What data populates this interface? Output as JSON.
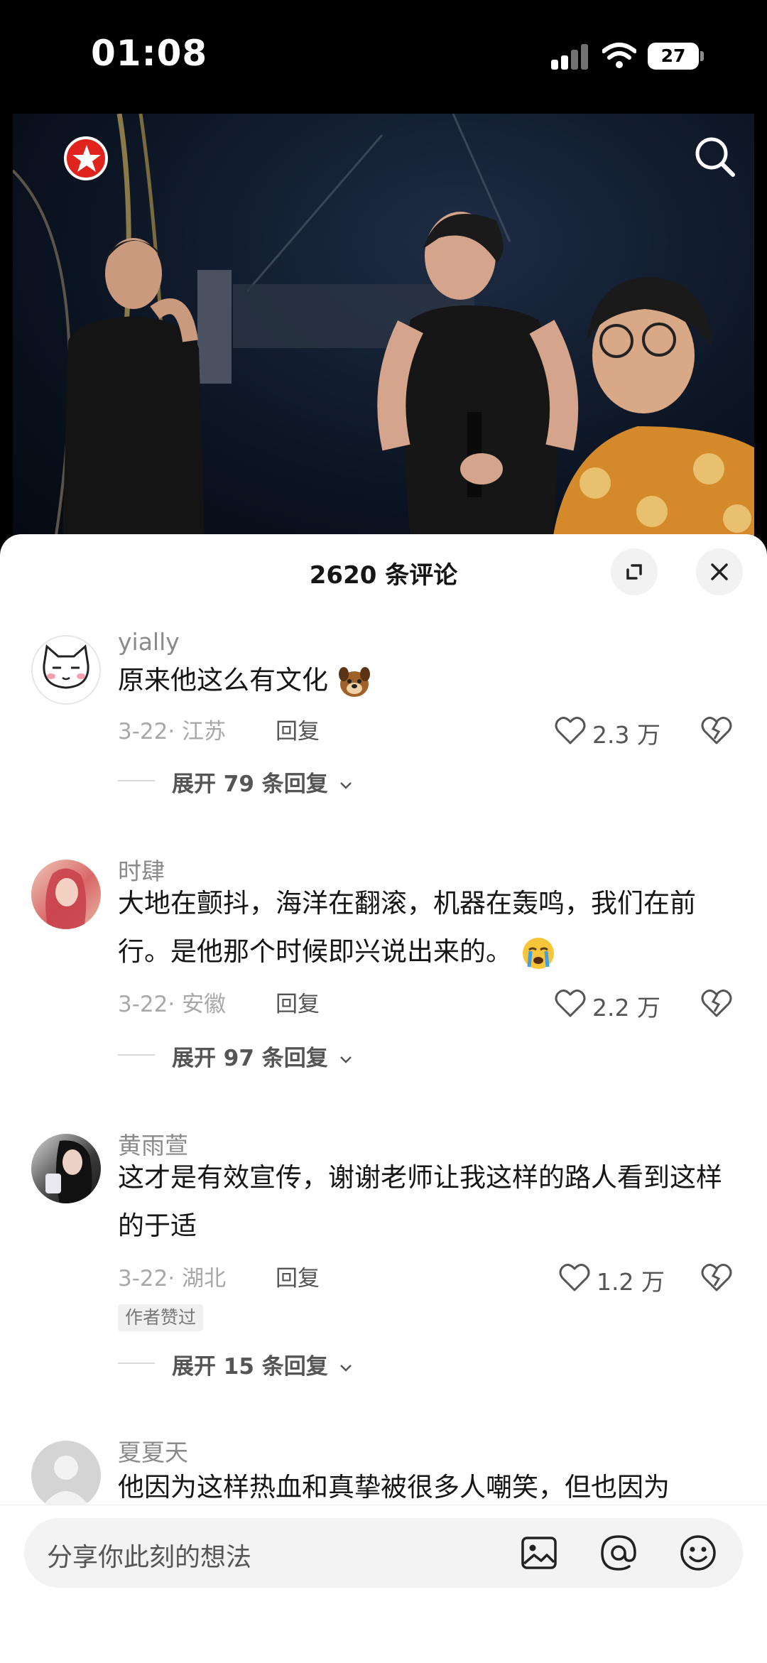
{
  "status_bar": {
    "time": "01:08",
    "battery": "27"
  },
  "header": {
    "title": "2620 条评论"
  },
  "comments": [
    {
      "user": "yially",
      "text": "原来他这么有文化",
      "date_location": "3-22· 江苏",
      "reply_label": "回复",
      "likes": "2.3 万",
      "expand": "展开 79 条回复"
    },
    {
      "user": "时肆",
      "text": "大地在颤抖，海洋在翻滚，机器在轰鸣，我们在前行。是他那个时候即兴说出来的。",
      "date_location": "3-22· 安徽",
      "reply_label": "回复",
      "likes": "2.2 万",
      "expand": "展开 97 条回复"
    },
    {
      "user": "黄雨萱",
      "text": "这才是有效宣传，谢谢老师让我这样的路人看到这样的于适",
      "date_location": "3-22· 湖北",
      "reply_label": "回复",
      "likes": "1.2 万",
      "badge": "作者赞过",
      "expand": "展开 15 条回复"
    },
    {
      "user": "夏夏天",
      "text": "他因为这样热血和真挚被很多人嘲笑，但也因为"
    }
  ],
  "input": {
    "placeholder": "分享你此刻的想法"
  },
  "colors": {
    "accent_red": "#e0231c",
    "text_primary": "#161616",
    "text_secondary": "#8a8a8a"
  }
}
